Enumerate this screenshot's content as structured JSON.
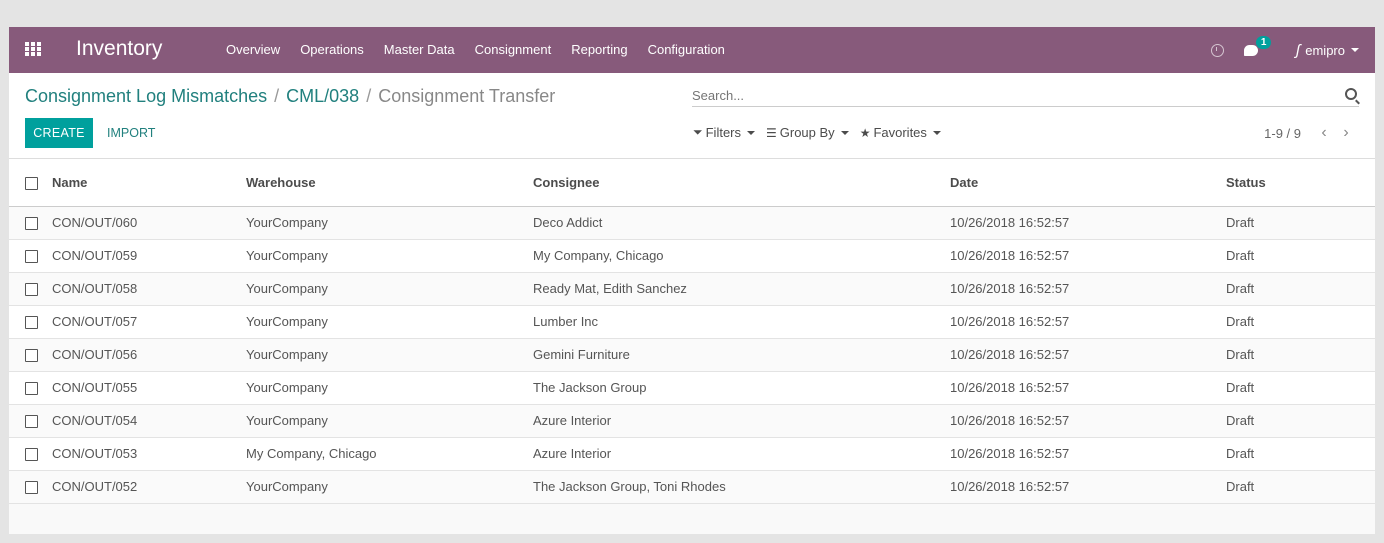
{
  "navbar": {
    "app_name": "Inventory",
    "menu": [
      "Overview",
      "Operations",
      "Master Data",
      "Consignment",
      "Reporting",
      "Configuration"
    ],
    "chat_badge": "1",
    "user": "emipro"
  },
  "breadcrumb": {
    "items": [
      "Consignment Log Mismatches",
      "CML/038"
    ],
    "separator": "/",
    "current": "Consignment Transfer"
  },
  "buttons": {
    "create": "CREATE",
    "import": "IMPORT"
  },
  "search": {
    "placeholder": "Search..."
  },
  "filters": {
    "filters": "Filters",
    "group_by": "Group By",
    "favorites": "Favorites"
  },
  "pager": {
    "value": "1-9 / 9"
  },
  "table": {
    "columns": [
      "Name",
      "Warehouse",
      "Consignee",
      "Date",
      "Status"
    ],
    "rows": [
      [
        "CON/OUT/060",
        "YourCompany",
        "Deco Addict",
        "10/26/2018 16:52:57",
        "Draft"
      ],
      [
        "CON/OUT/059",
        "YourCompany",
        "My Company, Chicago",
        "10/26/2018 16:52:57",
        "Draft"
      ],
      [
        "CON/OUT/058",
        "YourCompany",
        "Ready Mat, Edith Sanchez",
        "10/26/2018 16:52:57",
        "Draft"
      ],
      [
        "CON/OUT/057",
        "YourCompany",
        "Lumber Inc",
        "10/26/2018 16:52:57",
        "Draft"
      ],
      [
        "CON/OUT/056",
        "YourCompany",
        "Gemini Furniture",
        "10/26/2018 16:52:57",
        "Draft"
      ],
      [
        "CON/OUT/055",
        "YourCompany",
        "The Jackson Group",
        "10/26/2018 16:52:57",
        "Draft"
      ],
      [
        "CON/OUT/054",
        "YourCompany",
        "Azure Interior",
        "10/26/2018 16:52:57",
        "Draft"
      ],
      [
        "CON/OUT/053",
        "My Company, Chicago",
        "Azure Interior",
        "10/26/2018 16:52:57",
        "Draft"
      ],
      [
        "CON/OUT/052",
        "YourCompany",
        "The Jackson Group, Toni Rhodes",
        "10/26/2018 16:52:57",
        "Draft"
      ]
    ]
  },
  "colors": {
    "navbar": "#875a7b",
    "accent": "#00a09d",
    "link": "#21807e"
  }
}
